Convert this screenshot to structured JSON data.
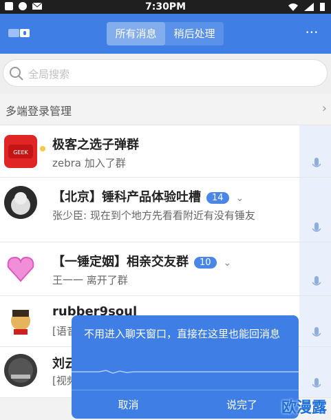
{
  "status_bar": {
    "time": "7:30PM"
  },
  "header": {
    "tabs": [
      {
        "label": "所有消息",
        "active": true
      },
      {
        "label": "稍后处理",
        "active": false
      }
    ],
    "more_label": "···"
  },
  "search": {
    "placeholder": "全局搜索"
  },
  "multi_device": {
    "label": "多端登录管理",
    "chevron": "›"
  },
  "conversations": [
    {
      "title": "极客之选子弹群",
      "subtitle": "zebra 加入了群",
      "badge": ""
    },
    {
      "title": "【北京】锤科产品体验吐槽",
      "subtitle": "张少臣: 现在到个地方先看看附近有没有锤友",
      "badge": "14"
    },
    {
      "title": "【一锤定姻】相亲交友群",
      "subtitle": "王一一 离开了群",
      "badge": "10"
    },
    {
      "title": "rubber9soul",
      "subtitle": "[语音]",
      "badge": ""
    },
    {
      "title": "刘云",
      "subtitle": "[视频]",
      "badge": ""
    }
  ],
  "popup": {
    "message": "不用进入聊天窗口，直接在这里也能回消息",
    "cancel": "取消",
    "done": "说完了"
  },
  "watermark": "欧漫露",
  "colors": {
    "accent": "#3f7fe5",
    "badge": "#4a86e8"
  }
}
